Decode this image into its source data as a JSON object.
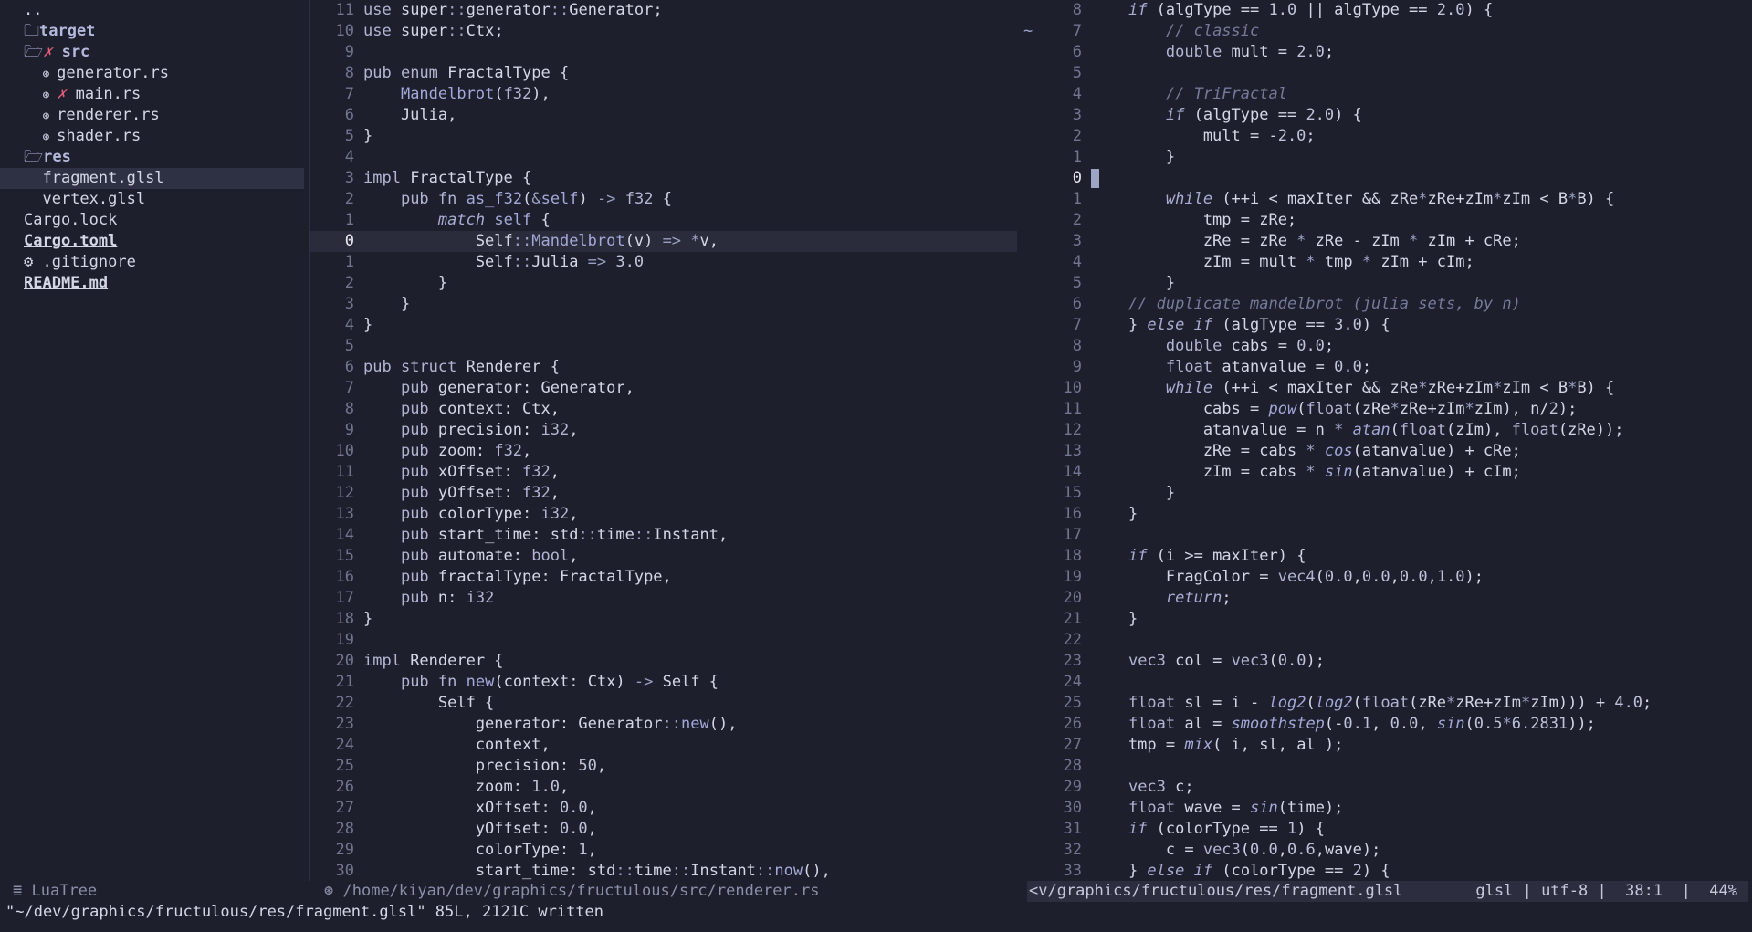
{
  "tree": {
    "items": [
      {
        "indent": "",
        "icon": "",
        "icon_name": "",
        "text": "..",
        "kind": "file",
        "x": ""
      },
      {
        "indent": "",
        "icon": "🗀",
        "icon_name": "folder-icon",
        "text": "target",
        "kind": "dir",
        "x": ""
      },
      {
        "indent": "",
        "icon": "🗁",
        "icon_name": "folder-open-icon",
        "text": "src",
        "kind": "dir",
        "x": "✗ "
      },
      {
        "indent": "  ",
        "icon": "⊛ ",
        "icon_name": "file-icon",
        "text": "generator.rs",
        "kind": "file",
        "x": ""
      },
      {
        "indent": "  ",
        "icon": "⊛ ",
        "icon_name": "file-icon",
        "text": "main.rs",
        "kind": "file",
        "x": "✗ "
      },
      {
        "indent": "  ",
        "icon": "⊛ ",
        "icon_name": "file-icon",
        "text": "renderer.rs",
        "kind": "file",
        "x": ""
      },
      {
        "indent": "  ",
        "icon": "⊛ ",
        "icon_name": "file-icon",
        "text": "shader.rs",
        "kind": "file",
        "x": ""
      },
      {
        "indent": "",
        "icon": "🗁",
        "icon_name": "folder-open-icon",
        "text": "res",
        "kind": "dir",
        "x": ""
      },
      {
        "indent": "  ",
        "icon": "",
        "icon_name": "",
        "text": "fragment.glsl",
        "kind": "file",
        "x": "",
        "selected": true
      },
      {
        "indent": "  ",
        "icon": "",
        "icon_name": "",
        "text": "vertex.glsl",
        "kind": "file",
        "x": ""
      },
      {
        "indent": "",
        "icon": "",
        "icon_name": "",
        "text": "Cargo.lock",
        "kind": "file",
        "x": ""
      },
      {
        "indent": "",
        "icon": "",
        "icon_name": "",
        "text": "Cargo.toml",
        "kind": "special",
        "x": ""
      },
      {
        "indent": "",
        "icon": "⚙ ",
        "icon_name": "gear-icon",
        "text": ".gitignore",
        "kind": "file",
        "x": ""
      },
      {
        "indent": "",
        "icon": "",
        "icon_name": "",
        "text": "README.md",
        "kind": "special",
        "x": ""
      }
    ]
  },
  "left_editor": {
    "lines": [
      {
        "n": "11",
        "code": "use super::generator::Generator;"
      },
      {
        "n": "10",
        "code": "use super::Ctx;"
      },
      {
        "n": "9",
        "code": ""
      },
      {
        "n": "8",
        "code": "pub enum FractalType {"
      },
      {
        "n": "7",
        "code": "    Mandelbrot(f32),"
      },
      {
        "n": "6",
        "code": "    Julia,"
      },
      {
        "n": "5",
        "code": "}"
      },
      {
        "n": "4",
        "code": ""
      },
      {
        "n": "3",
        "code": "impl FractalType {"
      },
      {
        "n": "2",
        "code": "    pub fn as_f32(&self) -> f32 {"
      },
      {
        "n": "1",
        "code": "        match self {"
      },
      {
        "n": "0",
        "code": "            Self::Mandelbrot(v) => *v,",
        "hl": true
      },
      {
        "n": "1",
        "code": "            Self::Julia => 3.0"
      },
      {
        "n": "2",
        "code": "        }"
      },
      {
        "n": "3",
        "code": "    }"
      },
      {
        "n": "4",
        "code": "}"
      },
      {
        "n": "5",
        "code": ""
      },
      {
        "n": "6",
        "code": "pub struct Renderer {"
      },
      {
        "n": "7",
        "code": "    pub generator: Generator,"
      },
      {
        "n": "8",
        "code": "    pub context: Ctx,"
      },
      {
        "n": "9",
        "code": "    pub precision: i32,"
      },
      {
        "n": "10",
        "code": "    pub zoom: f32,"
      },
      {
        "n": "11",
        "code": "    pub xOffset: f32,"
      },
      {
        "n": "12",
        "code": "    pub yOffset: f32,"
      },
      {
        "n": "13",
        "code": "    pub colorType: i32,"
      },
      {
        "n": "14",
        "code": "    pub start_time: std::time::Instant,"
      },
      {
        "n": "15",
        "code": "    pub automate: bool,"
      },
      {
        "n": "16",
        "code": "    pub fractalType: FractalType,"
      },
      {
        "n": "17",
        "code": "    pub n: i32"
      },
      {
        "n": "18",
        "code": "}"
      },
      {
        "n": "19",
        "code": ""
      },
      {
        "n": "20",
        "code": "impl Renderer {"
      },
      {
        "n": "21",
        "code": "    pub fn new(context: Ctx) -> Self {"
      },
      {
        "n": "22",
        "code": "        Self {"
      },
      {
        "n": "23",
        "code": "            generator: Generator::new(),"
      },
      {
        "n": "24",
        "code": "            context,"
      },
      {
        "n": "25",
        "code": "            precision: 50,"
      },
      {
        "n": "26",
        "code": "            zoom: 1.0,"
      },
      {
        "n": "27",
        "code": "            xOffset: 0.0,"
      },
      {
        "n": "28",
        "code": "            yOffset: 0.0,"
      },
      {
        "n": "29",
        "code": "            colorType: 1,"
      },
      {
        "n": "30",
        "code": "            start_time: std::time::Instant::now(),"
      }
    ]
  },
  "right_editor": {
    "lines": [
      {
        "n": "8",
        "sign": "",
        "code": "    if (algType == 1.0 || algType == 2.0) {"
      },
      {
        "n": "7",
        "sign": "~",
        "code": "        // classic"
      },
      {
        "n": "6",
        "sign": "",
        "code": "        double mult = 2.0;"
      },
      {
        "n": "5",
        "sign": "",
        "code": ""
      },
      {
        "n": "4",
        "sign": "",
        "code": "        // TriFractal"
      },
      {
        "n": "3",
        "sign": "",
        "code": "        if (algType == 2.0) {"
      },
      {
        "n": "2",
        "sign": "",
        "code": "            mult = -2.0;"
      },
      {
        "n": "1",
        "sign": "",
        "code": "        }"
      },
      {
        "n": "0",
        "sign": "",
        "code": "",
        "cursor": true
      },
      {
        "n": "1",
        "sign": "",
        "code": "        while (++i < maxIter && zRe*zRe+zIm*zIm < B*B) {"
      },
      {
        "n": "2",
        "sign": "",
        "code": "            tmp = zRe;"
      },
      {
        "n": "3",
        "sign": "",
        "code": "            zRe = zRe * zRe - zIm * zIm + cRe;"
      },
      {
        "n": "4",
        "sign": "",
        "code": "            zIm = mult * tmp * zIm + cIm;"
      },
      {
        "n": "5",
        "sign": "",
        "code": "        }"
      },
      {
        "n": "6",
        "sign": "",
        "code": "    // duplicate mandelbrot (julia sets, by n)"
      },
      {
        "n": "7",
        "sign": "",
        "code": "    } else if (algType == 3.0) {"
      },
      {
        "n": "8",
        "sign": "",
        "code": "        double cabs = 0.0;"
      },
      {
        "n": "9",
        "sign": "",
        "code": "        float atanvalue = 0.0;"
      },
      {
        "n": "10",
        "sign": "",
        "code": "        while (++i < maxIter && zRe*zRe+zIm*zIm < B*B) {"
      },
      {
        "n": "11",
        "sign": "",
        "code": "            cabs = pow(float(zRe*zRe+zIm*zIm), n/2);"
      },
      {
        "n": "12",
        "sign": "",
        "code": "            atanvalue = n * atan(float(zIm), float(zRe));"
      },
      {
        "n": "13",
        "sign": "",
        "code": "            zRe = cabs * cos(atanvalue) + cRe;"
      },
      {
        "n": "14",
        "sign": "",
        "code": "            zIm = cabs * sin(atanvalue) + cIm;"
      },
      {
        "n": "15",
        "sign": "",
        "code": "        }"
      },
      {
        "n": "16",
        "sign": "",
        "code": "    }"
      },
      {
        "n": "17",
        "sign": "",
        "code": ""
      },
      {
        "n": "18",
        "sign": "",
        "code": "    if (i >= maxIter) {"
      },
      {
        "n": "19",
        "sign": "",
        "code": "        FragColor = vec4(0.0,0.0,0.0,1.0);"
      },
      {
        "n": "20",
        "sign": "",
        "code": "        return;"
      },
      {
        "n": "21",
        "sign": "",
        "code": "    }"
      },
      {
        "n": "22",
        "sign": "",
        "code": ""
      },
      {
        "n": "23",
        "sign": "",
        "code": "    vec3 col = vec3(0.0);"
      },
      {
        "n": "24",
        "sign": "",
        "code": ""
      },
      {
        "n": "25",
        "sign": "",
        "code": "    float sl = i - log2(log2(float(zRe*zRe+zIm*zIm))) + 4.0;"
      },
      {
        "n": "26",
        "sign": "",
        "code": "    float al = smoothstep(-0.1, 0.0, sin(0.5*6.2831));"
      },
      {
        "n": "27",
        "sign": "",
        "code": "    tmp = mix( i, sl, al );"
      },
      {
        "n": "28",
        "sign": "",
        "code": ""
      },
      {
        "n": "29",
        "sign": "",
        "code": "    vec3 c;"
      },
      {
        "n": "30",
        "sign": "",
        "code": "    float wave = sin(time);"
      },
      {
        "n": "31",
        "sign": "",
        "code": "    if (colorType == 1) {"
      },
      {
        "n": "32",
        "sign": "",
        "code": "        c = vec3(0.0,0.6,wave);"
      },
      {
        "n": "33",
        "sign": "",
        "code": "    } else if (colorType == 2) {"
      }
    ]
  },
  "status": {
    "tree_icon": "≣",
    "tree_label": "LuaTree",
    "left_icon": "⊛",
    "left_path": "/home/kiyan/dev/graphics/fructulous/src/renderer.rs",
    "right_path": "<v/graphics/fructulous/res/fragment.glsl",
    "right_info": "glsl | utf-8 |  38:1  |  44%"
  },
  "cmdline": "\"~/dev/graphics/fructulous/res/fragment.glsl\" 85L, 2121C written",
  "colors": {
    "background": "#1d1f2d",
    "selection": "#2e3043",
    "error_x": "#e05c78",
    "status_active": "#2c2e40"
  }
}
